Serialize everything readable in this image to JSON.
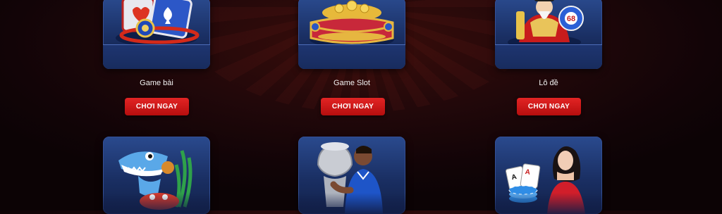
{
  "games": [
    {
      "name": "Game bài",
      "button": "CHƠI NGAY",
      "icon": "cards-icon"
    },
    {
      "name": "Game Slot",
      "button": "CHƠI NGAY",
      "icon": "treasure-chest-icon"
    },
    {
      "name": "Lô đề",
      "button": "CHƠI NGAY",
      "icon": "lottery-god-icon"
    }
  ],
  "bottom_cards": [
    {
      "icon": "shark-fishing-icon"
    },
    {
      "icon": "football-trophy-icon"
    },
    {
      "icon": "live-casino-dealer-icon"
    }
  ],
  "lottery_ball_number": "68",
  "colors": {
    "accent": "#d11717",
    "card": "#1f3670",
    "background": "#1a0608"
  }
}
